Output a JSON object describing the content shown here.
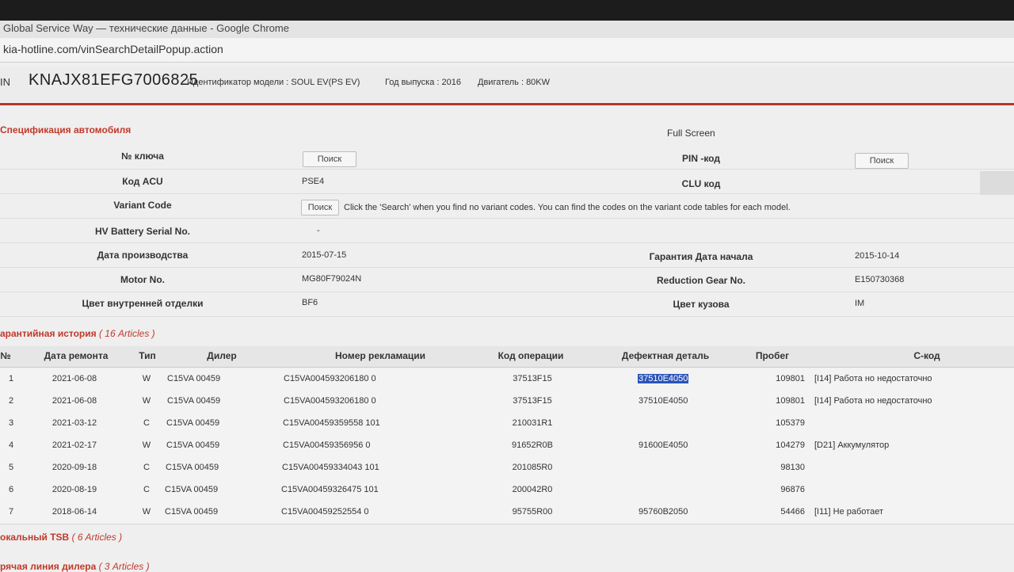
{
  "browser": {
    "window_title": "Global Service Way — технические данные - Google Chrome",
    "url": "kia-hotline.com/vinSearchDetailPopup.action"
  },
  "header": {
    "vin_label": "IN",
    "vin": "KNAJX81EFG7006825",
    "model": "Идентификатор модели : SOUL EV(PS EV)",
    "year": "Год выпуска : 2016",
    "engine": "Двигатель : 80KW"
  },
  "spec": {
    "title": "Спецификация автомобиля",
    "full_screen": "Full Screen",
    "key_no_label": "№ ключа",
    "key_search_button": "Поиск",
    "pin_label": "PIN -код",
    "pin_search_button": "Поиск",
    "acu_label": "Код ACU",
    "acu_value": "PSE4",
    "clu_label": "CLU код",
    "variant_label": "Variant Code",
    "variant_search_button": "Поиск",
    "variant_hint": "Click the 'Search' when you find no variant codes. You can find the codes on the variant code tables for each model.",
    "hv_label": "HV Battery Serial No.",
    "hv_value": "-",
    "prod_date_label": "Дата производства",
    "prod_date_value": "2015-07-15",
    "warranty_label": "Гарантия Дата начала",
    "warranty_value": "2015-10-14",
    "motor_label": "Motor No.",
    "motor_value": "MG80F79024N",
    "gear_label": "Reduction Gear No.",
    "gear_value": "E150730368",
    "interior_label": "Цвет внутренней отделки",
    "interior_value": "BF6",
    "body_color_label": "Цвет кузова",
    "body_color_value": "IM"
  },
  "warranty_history": {
    "title": "арантийная история",
    "count": "( 16 Articles )",
    "columns": [
      "№",
      "Дата ремонта",
      "Тип",
      "Дилер",
      "Номер рекламации",
      "Код операции",
      "Дефектная деталь",
      "Пробег",
      "С-код"
    ],
    "rows": [
      {
        "no": "1",
        "date": "2021-06-08",
        "type": "W",
        "dealer": "C15VA 00459",
        "claim": "C15VA004593206180 0",
        "op": "37513F15",
        "part": "37510E4050",
        "mileage": "109801",
        "ccode": "[I14] Работа но недостаточно"
      },
      {
        "no": "2",
        "date": "2021-06-08",
        "type": "W",
        "dealer": "C15VA 00459",
        "claim": "C15VA004593206180 0",
        "op": "37513F15",
        "part": "37510E4050",
        "mileage": "109801",
        "ccode": "[I14] Работа но недостаточно"
      },
      {
        "no": "3",
        "date": "2021-03-12",
        "type": "C",
        "dealer": "C15VA 00459",
        "claim": "C15VA00459359558 101",
        "op": "210031R1",
        "part": "",
        "mileage": "105379",
        "ccode": ""
      },
      {
        "no": "4",
        "date": "2021-02-17",
        "type": "W",
        "dealer": "C15VA 00459",
        "claim": "C15VA00459356956 0",
        "op": "91652R0B",
        "part": "91600E4050",
        "mileage": "104279",
        "ccode": "[D21] Аккумулятор"
      },
      {
        "no": "5",
        "date": "2020-09-18",
        "type": "C",
        "dealer": "C15VA 00459",
        "claim": "C15VA00459334043 101",
        "op": "201085R0",
        "part": "",
        "mileage": "98130",
        "ccode": ""
      },
      {
        "no": "6",
        "date": "2020-08-19",
        "type": "C",
        "dealer": "C15VA 00459",
        "claim": "C15VA00459326475 101",
        "op": "200042R0",
        "part": "",
        "mileage": "96876",
        "ccode": ""
      },
      {
        "no": "7",
        "date": "2018-06-14",
        "type": "W",
        "dealer": "C15VA 00459",
        "claim": "C15VA00459252554 0",
        "op": "95755R00",
        "part": "95760B2050",
        "mileage": "54466",
        "ccode": "[I11] Не работает"
      }
    ]
  },
  "local_tsb": {
    "title": "окальный TSB",
    "count": "( 6 Articles )"
  },
  "hotline": {
    "title": "рячая линия дилера",
    "count": "( 3 Articles )"
  },
  "colors": {
    "accent_red": "#c0392b",
    "selection_blue": "#2b54b8"
  }
}
